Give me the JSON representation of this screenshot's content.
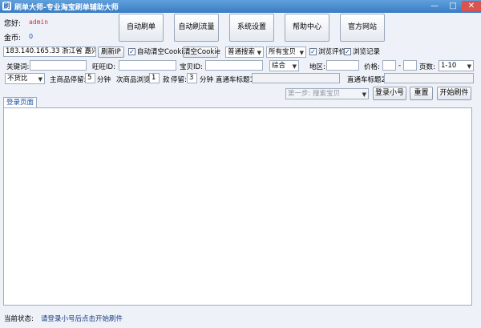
{
  "window": {
    "title": "刷单大师-专业淘宝刷单辅助大师",
    "controls": [
      "—",
      "□",
      "✕"
    ]
  },
  "account": {
    "user_label": "您好:",
    "user_value": "admin",
    "coins_label": "金币:",
    "coins_value": "0"
  },
  "nav": [
    {
      "label": "自动刷单"
    },
    {
      "label": "自动刷流量"
    },
    {
      "label": "系统设置"
    },
    {
      "label": "帮助中心"
    },
    {
      "label": "官方网站"
    }
  ],
  "row1": {
    "ip_value": "183.140.165.33 浙江省 嘉兴市",
    "refresh_ip_label": "刷新IP",
    "auto_clear_cookie_label": "自动清空Cookie",
    "auto_clear_cookie_checked": true,
    "clear_cookie_label": "清空Cookie",
    "search_mode": "普通搜索",
    "item_scope": "所有宝贝",
    "browse_reviews_label": "浏览评价",
    "browse_reviews_checked": true,
    "browse_records_label": "浏览记录",
    "browse_records_checked": true
  },
  "row2": {
    "keyword_label": "关键词:",
    "keyword_value": "",
    "wangwang_label": "旺旺ID:",
    "wangwang_value": "",
    "item_id_label": "宝贝ID:",
    "item_id_value": "",
    "sort_value": "综合",
    "region_label": "地区:",
    "region_value": "",
    "price_label": "价格:",
    "price_min": "",
    "price_sep": "-",
    "price_max": "",
    "pages_label": "页数:",
    "pages_value": "1-10"
  },
  "row3": {
    "compare_value": "不货比",
    "main_stay_label": "主商品停留:",
    "main_stay_value": "5",
    "minutes_label_1": "分钟",
    "secondary_browse_label": "次商品浏览",
    "secondary_count": "1",
    "unit_label": "款",
    "stay_label": "停留:",
    "stay_value": "3",
    "minutes_label_2": "分钟",
    "train_title1_label": "直通车标题1:",
    "train_title1_value": "",
    "train_title2_label": "直通车标题2:",
    "train_title2_value": ""
  },
  "actions": {
    "step_select": "第一步: 搜索宝贝",
    "login_small_label": "登录小号",
    "reset_label": "重置",
    "start_label": "开始刷件"
  },
  "log": {
    "tab_label": "登录页面"
  },
  "status": {
    "label": "当前状态:",
    "value": "请登录小号后点击开始刷件"
  }
}
